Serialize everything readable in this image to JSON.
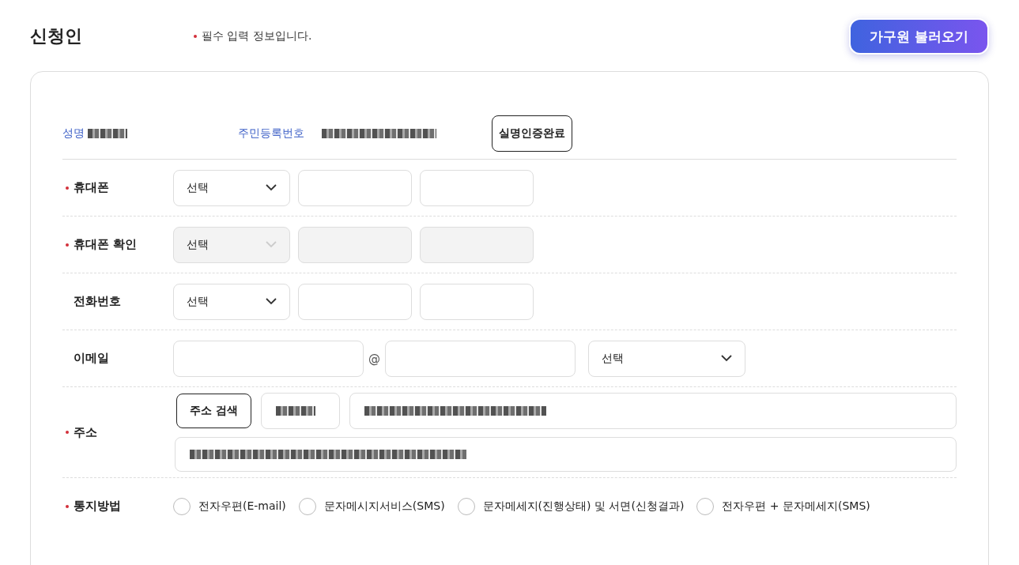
{
  "header": {
    "title": "신청인",
    "required_note": "필수 입력 정보입니다.",
    "load_button": "가구원 불러오기"
  },
  "identity": {
    "name_label": "성명",
    "name_masked": true,
    "rrn_label": "주민등록번호",
    "rrn_masked": true,
    "verify_button": "실명인증완료"
  },
  "rows": [
    {
      "kind": "phone",
      "label": "휴대폰",
      "required": true,
      "disabled": false,
      "select": "선택"
    },
    {
      "kind": "phone",
      "label": "휴대폰 확인",
      "required": true,
      "disabled": true,
      "select": "선택"
    },
    {
      "kind": "phone",
      "label": "전화번호",
      "required": false,
      "disabled": false,
      "select": "선택"
    },
    {
      "kind": "email",
      "label": "이메일",
      "required": false,
      "separator": "@",
      "select": "선택"
    },
    {
      "kind": "address",
      "label": "주소",
      "required": true,
      "search_button": "주소 검색",
      "masked": true
    },
    {
      "kind": "radio",
      "label": "통지방법",
      "required": true,
      "options": [
        {
          "label": "전자우편(E-mail)",
          "selected": false
        },
        {
          "label": "문자메시지서비스(SMS)",
          "selected": false
        },
        {
          "label": "문자메세지(진행상태) 및 서면(신청결과)",
          "selected": false
        },
        {
          "label": "전자우편 + 문자메세지(SMS)",
          "selected": false
        }
      ]
    }
  ]
}
